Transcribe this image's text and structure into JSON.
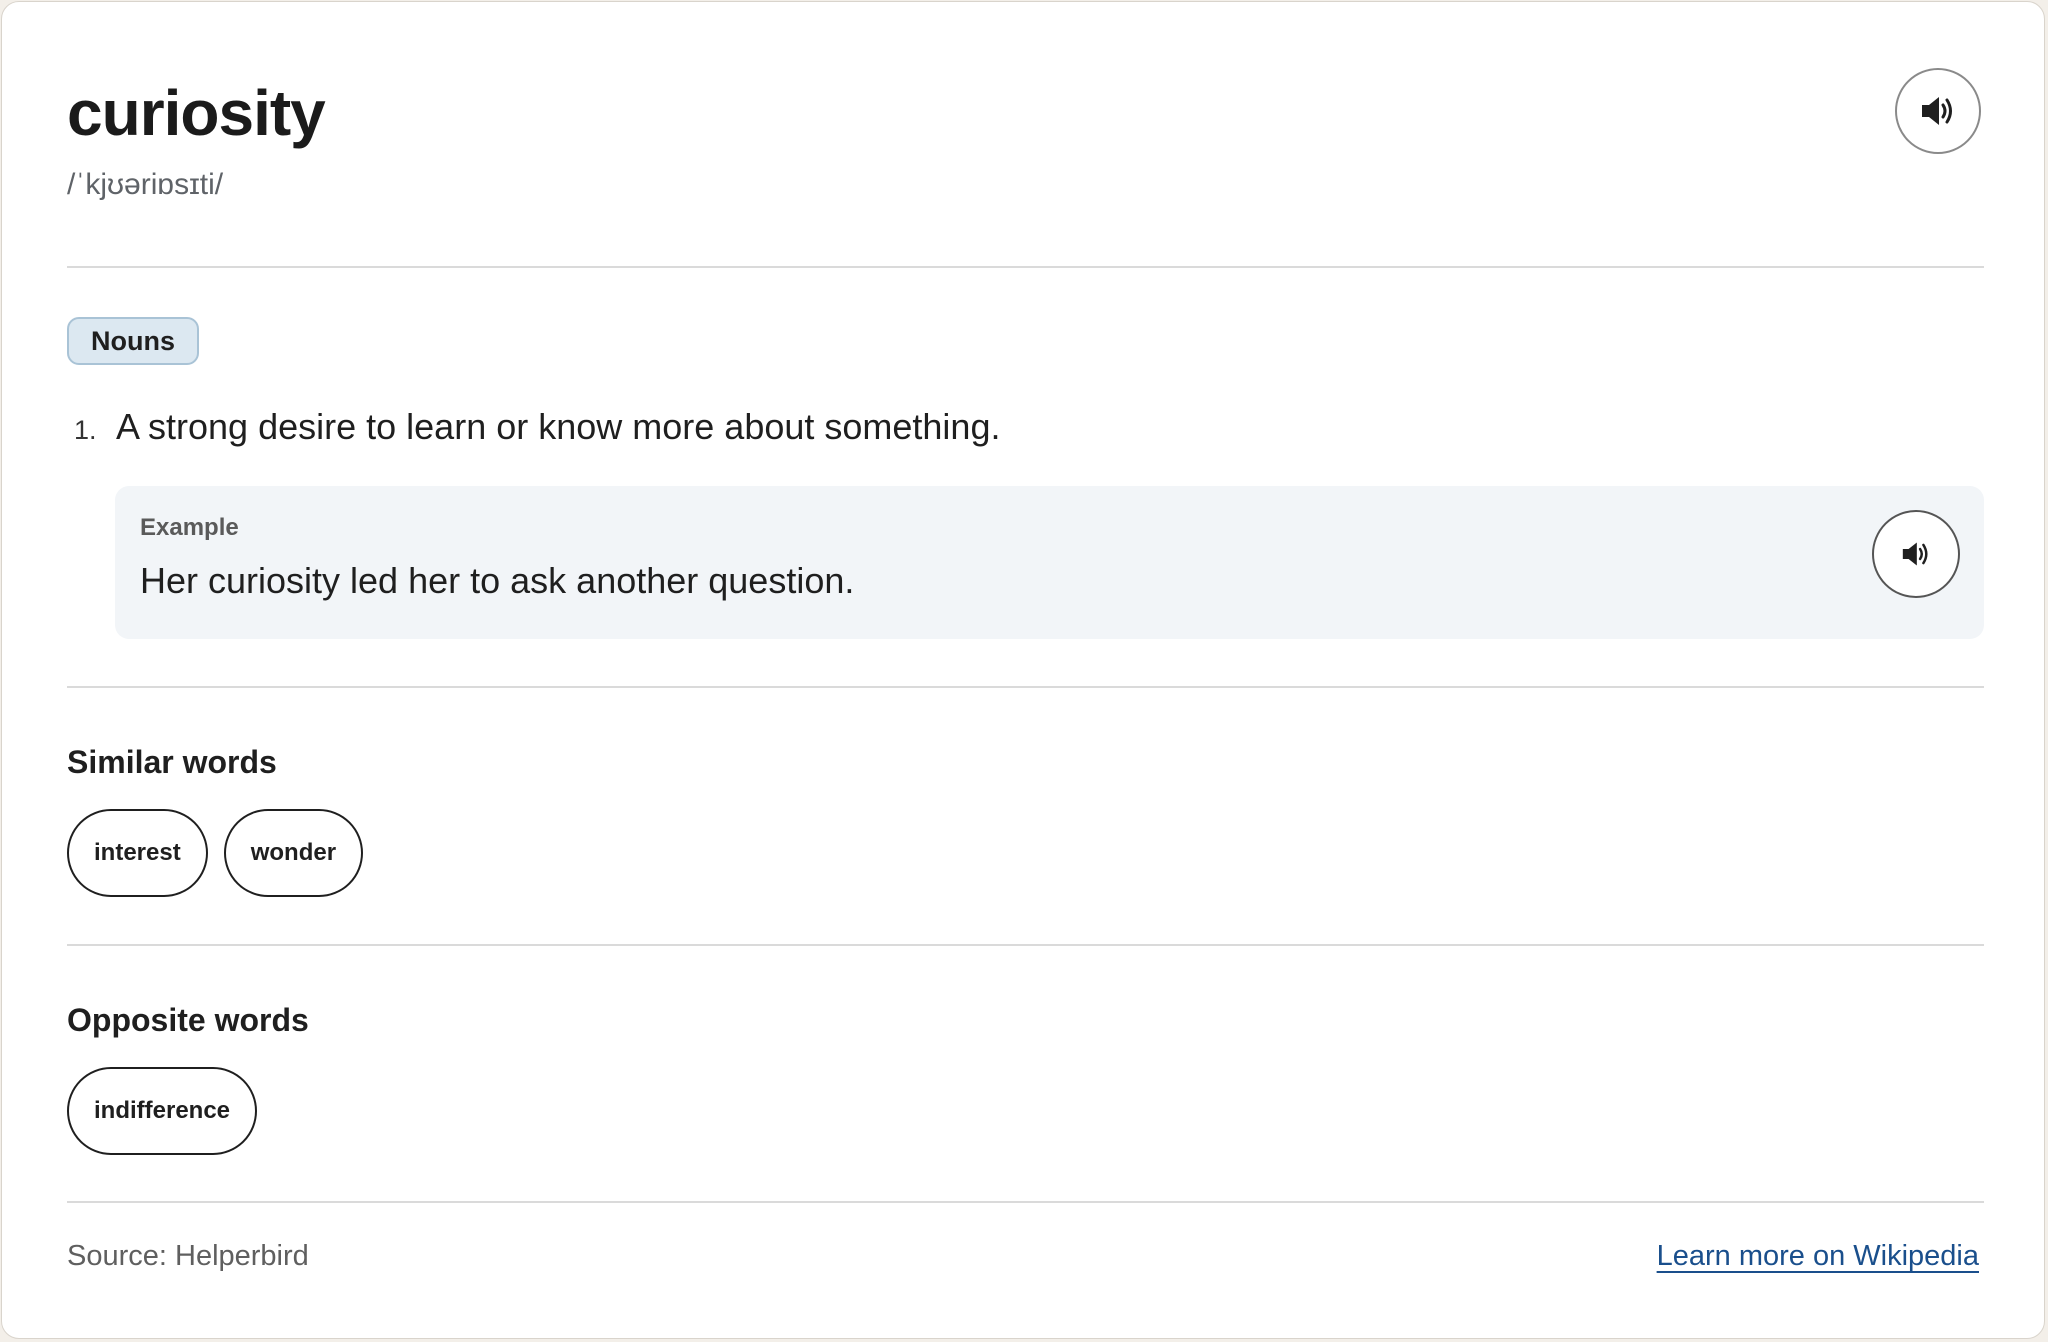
{
  "entry": {
    "word": "curiosity",
    "pronunciation": "/ˈkjʊəriɒsɪti/"
  },
  "definition_block": {
    "part_of_speech": "Nouns",
    "definitions": [
      {
        "number": "1.",
        "text": "A strong desire to learn or know more about something.",
        "example_label": "Example",
        "example_text": "Her curiosity led her to ask another question."
      }
    ]
  },
  "similar": {
    "title": "Similar words",
    "words": [
      "interest",
      "wonder"
    ]
  },
  "opposite": {
    "title": "Opposite words",
    "words": [
      "indifference"
    ]
  },
  "footer": {
    "source": "Source: Helperbird",
    "link": "Learn more on Wikipedia"
  },
  "icons": {
    "pronounce": "speaker-icon",
    "example_audio": "speaker-icon"
  },
  "colors": {
    "badge_bg": "#dce8f1",
    "example_bg": "#f2f5f8",
    "link": "#1a4f8c"
  }
}
